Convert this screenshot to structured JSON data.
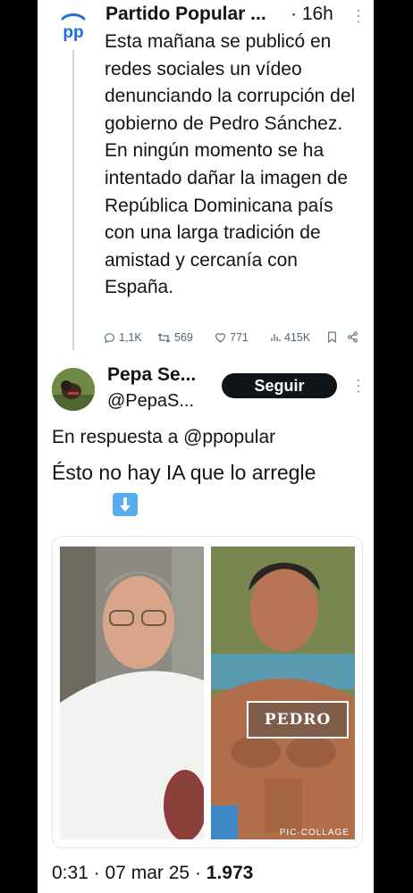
{
  "tweet": {
    "author_name": "Partido Popular ...",
    "time": "· 16h",
    "logo_text": "pp",
    "text": "Esta mañana se publicó en redes sociales un vídeo denunciando la corrupción del gobierno de Pedro Sánchez. En ningún momento se ha intentado dañar la imagen de República Dominicana país con una larga tradición de amistad y cercanía con España.",
    "stats": {
      "replies": "1,1K",
      "reposts": "569",
      "likes": "771",
      "views": "415K"
    }
  },
  "reply": {
    "author_name": "Pepa Se...",
    "handle": "@PepaS...",
    "follow_label": "Seguir",
    "reply_to": "En respuesta a @ppopular",
    "text": "Ésto no hay IA que lo arregle",
    "emoji": "⬇️",
    "image_label": "PEDRO",
    "watermark": "PIC·COLLAGE",
    "footer": {
      "time": "0:31",
      "date": "07 mar 25",
      "views": "1.973"
    }
  },
  "colors": {
    "brand": "#1d6fd1",
    "text": "#0f1419",
    "muted": "#536471",
    "follow_bg": "#0f1419"
  }
}
